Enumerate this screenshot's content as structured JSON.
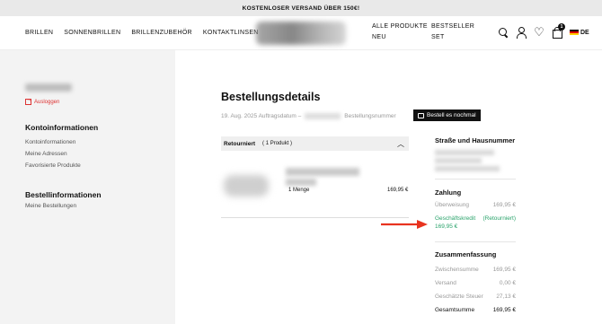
{
  "promo": "KOSTENLOSER VERSAND ÜBER 150€!",
  "nav_left": [
    "BRILLEN",
    "SONNENBRILLEN",
    "BRILLENZUBEHÖR",
    "KONTAKTLINSEN"
  ],
  "nav_right": [
    "ALLE PRODUKTE",
    "BESTSELLER",
    "NEU",
    "SET"
  ],
  "cart_count": "1",
  "language": "DE",
  "colors": {
    "accent_red": "#dd3322",
    "success_green": "#2aa36b",
    "sidebar_bg": "#f3f3f3"
  },
  "sidebar": {
    "logout": "Ausloggen",
    "account_heading": "Kontoinformationen",
    "account_links": [
      "Kontoinformationen",
      "Meine Adressen",
      "Favorisierte Produkte"
    ],
    "orders_heading": "Bestellinformationen",
    "orders_links": [
      "Meine Bestellungen"
    ]
  },
  "main": {
    "title": "Bestellungsdetails",
    "order_date": "19. Aug. 2025 Auftragsdatum –",
    "order_number_label": "Bestellungsnummer",
    "reorder_button": "Bestell es nochmal",
    "status": "Retourniert",
    "product_count": "( 1 Produkt )",
    "item_qty": "1 Menge",
    "item_price": "169,95 €"
  },
  "right": {
    "address_heading": "Straße und Hausnummer",
    "payment_heading": "Zahlung",
    "payment_method": "Überweisung",
    "payment_method_amount": "169,95 €",
    "credit_label": "Geschäftskredit",
    "credit_status": "(Retourniert)",
    "credit_amount": "169,95 €",
    "summary_heading": "Zusammenfassung",
    "subtotal_label": "Zwischensumme",
    "subtotal_value": "169,95 €",
    "shipping_label": "Versand",
    "shipping_value": "0,00 €",
    "tax_label": "Geschätzte Steuer",
    "tax_value": "27,13 €",
    "total_label": "Gesamtsumme",
    "total_value": "169,95 €"
  }
}
